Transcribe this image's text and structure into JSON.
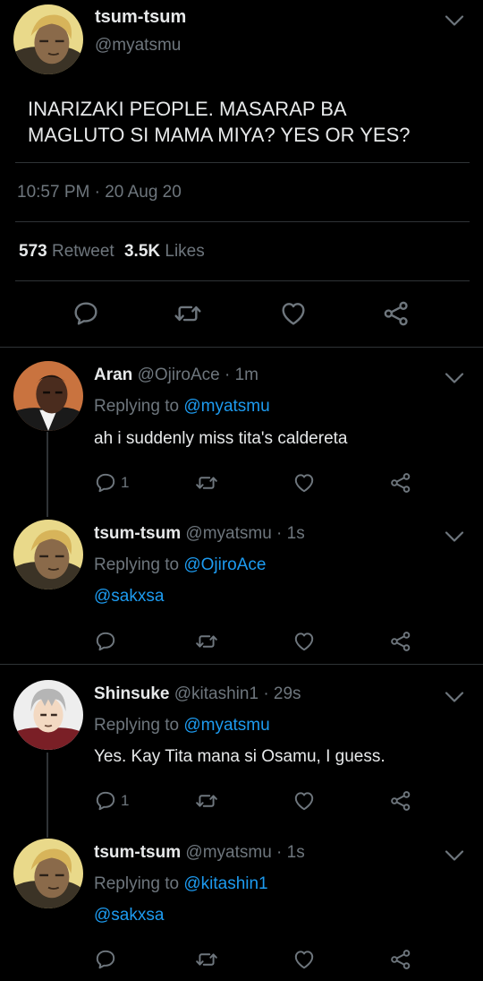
{
  "main_tweet": {
    "display_name": "tsum-tsum",
    "handle": "@myatsmu",
    "text_line1": "INARIZAKI PEOPLE. MASARAP BA",
    "text_line2": "MAGLUTO SI MAMA MIYA? YES OR YES?",
    "timestamp": "10:57 PM · 20 Aug 20",
    "retweets_count": "573",
    "retweets_label": "Retweet",
    "likes_count": "3.5K",
    "likes_label": "Likes"
  },
  "replies": [
    {
      "display_name": "Aran",
      "handle_time": "@OjiroAce · 1m",
      "replying_prefix": "Replying to ",
      "replying_to": "@myatsmu",
      "text": "ah i suddenly miss tita's caldereta",
      "reply_count": "1"
    },
    {
      "display_name": "tsum-tsum",
      "handle_time": "@myatsmu · 1s",
      "replying_prefix": "Replying to ",
      "replying_to": "@OjiroAce",
      "text": "@sakxsa",
      "reply_count": ""
    },
    {
      "display_name": "Shinsuke",
      "handle_time": "@kitashin1 · 29s",
      "replying_prefix": "Replying to ",
      "replying_to": "@myatsmu",
      "text": "Yes. Kay Tita mana si Osamu, I guess.",
      "reply_count": "1"
    },
    {
      "display_name": "tsum-tsum",
      "handle_time": "@myatsmu · 1s",
      "replying_prefix": "Replying to ",
      "replying_to": "@kitashin1",
      "text": "@sakxsa",
      "reply_count": ""
    }
  ],
  "icons": {
    "reply": "comment-bubble-icon",
    "retweet": "retweet-arrows-icon",
    "like": "heart-icon",
    "share": "share-nodes-icon",
    "more": "chevron-down-icon"
  },
  "colors": {
    "background": "#000000",
    "text": "#e7e9ea",
    "secondary": "#6e767d",
    "link": "#1d9bf0",
    "divider": "#2f3336"
  }
}
